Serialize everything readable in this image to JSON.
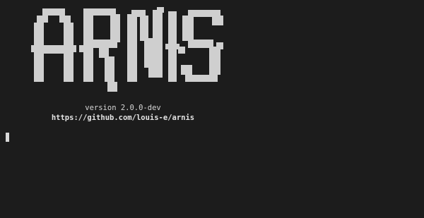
{
  "app": {
    "ascii_logo_text": "ARNIS",
    "version_label": "version 2.0.0-dev",
    "repo_url": "https://github.com/louis-e/arnis"
  },
  "colors": {
    "background": "#1c1c1c",
    "foreground": "#d6d6d6",
    "logo": "#cfcfcf",
    "cursor": "#d8d8d8"
  },
  "terminal": {
    "cursor_icon": "block-cursor"
  }
}
